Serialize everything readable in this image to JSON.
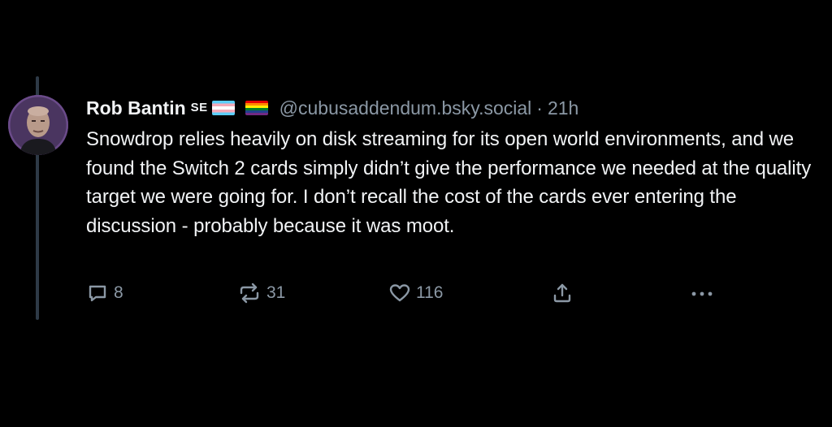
{
  "post": {
    "author": {
      "display_name": "Rob Bantin",
      "name_suffix": "SE",
      "handle": "@cubusaddendum.bsky.social",
      "separator": "·",
      "time": "21h"
    },
    "text": "Snowdrop relies heavily on disk streaming for its open world environments, and we found the Switch 2 cards simply didn’t give the performance we needed at the quality target we were going for. I don’t recall the cost of the cards ever entering the discussion - probably because it was moot.",
    "actions": {
      "reply_count": "8",
      "repost_count": "31",
      "like_count": "116"
    }
  },
  "icons": {
    "avatar": "avatar-photo",
    "flag_1": "trans-flag-emoji",
    "flag_2": "rainbow-flag-emoji",
    "reply": "reply-icon",
    "repost": "repost-icon",
    "like": "heart-icon",
    "share": "share-icon",
    "more": "more-dots-icon"
  },
  "colors": {
    "background": "#000000",
    "text": "#f1f3f5",
    "muted": "#8b98a5",
    "thread_line": "#2e3a47"
  }
}
